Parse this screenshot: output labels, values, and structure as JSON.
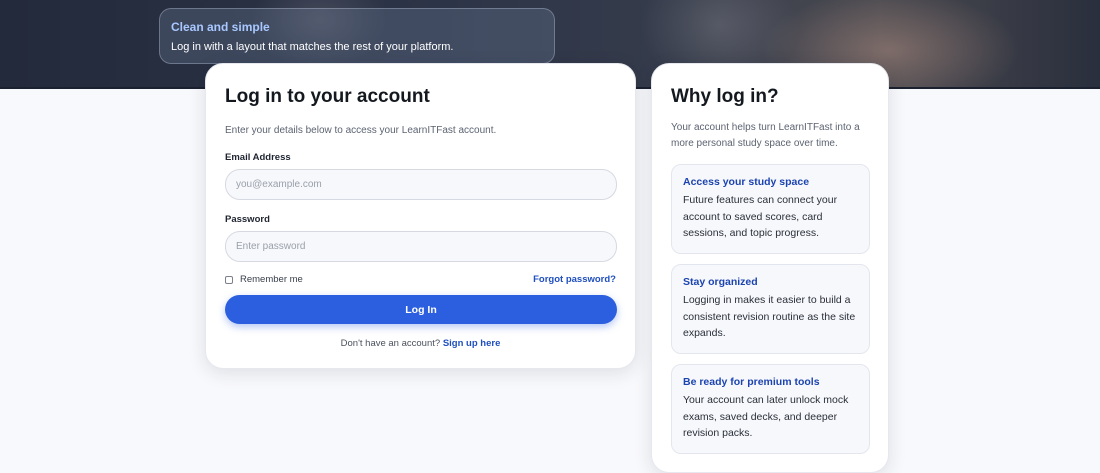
{
  "banner": {
    "title": "Clean and simple",
    "text": "Log in with a layout that matches the rest of your platform."
  },
  "login": {
    "title": "Log in to your account",
    "subtitle": "Enter your details below to access your LearnITFast account.",
    "email_label": "Email Address",
    "email_placeholder": "you@example.com",
    "email_value": "",
    "password_label": "Password",
    "password_placeholder": "Enter password",
    "password_value": "",
    "remember_label": "Remember me",
    "remember_checked": false,
    "forgot_link": "Forgot password?",
    "submit_label": "Log In",
    "signup_prompt": "Don't have an account?",
    "signup_link": "Sign up here"
  },
  "why": {
    "title": "Why log in?",
    "subtitle": "Your account helps turn LearnITFast into a more personal study space over time.",
    "benefits": [
      {
        "title": "Access your study space",
        "text": "Future features can connect your account to saved scores, card sessions, and topic progress."
      },
      {
        "title": "Stay organized",
        "text": "Logging in makes it easier to build a consistent revision routine as the site expands."
      },
      {
        "title": "Be ready for premium tools",
        "text": "Your account can later unlock mock exams, saved decks, and deeper revision packs."
      }
    ]
  },
  "colors": {
    "primary": "#2c5fe0",
    "link": "#1f4fbf",
    "benefit_title": "#1c44b0",
    "banner_title": "#a8c8ff"
  }
}
